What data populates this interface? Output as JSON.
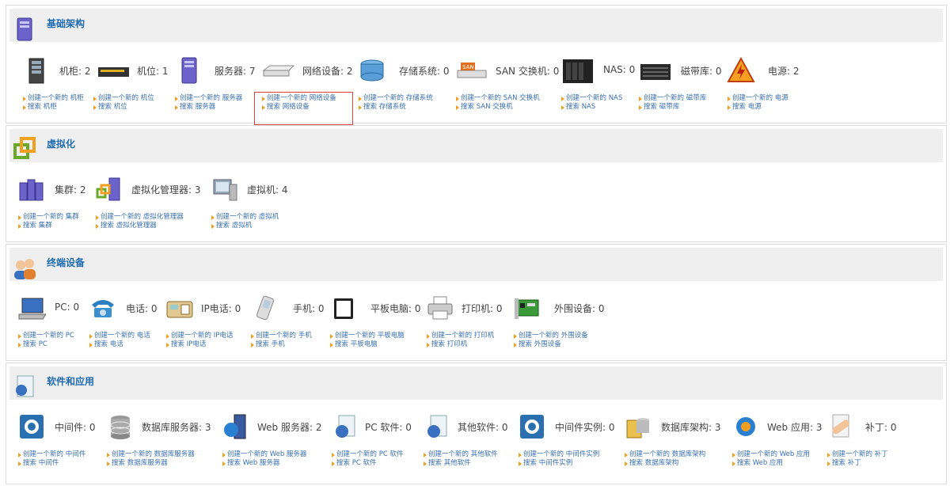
{
  "sections": [
    {
      "title": "基础架构",
      "items": [
        {
          "label": "机柜: 2",
          "create": "创建一个新的 机柜",
          "search": "搜索 机柜"
        },
        {
          "label": "机位: 1",
          "create": "创建一个新的 机位",
          "search": "搜索 机位"
        },
        {
          "label": "服务器: 7",
          "create": "创建一个新的 服务器",
          "search": "搜索 服务器"
        },
        {
          "label": "网络设备: 2",
          "create": "创建一个新的 网络设备",
          "search": "搜索 网络设备"
        },
        {
          "label": "存储系统: 0",
          "create": "创建一个新的 存储系统",
          "search": "搜索 存储系统"
        },
        {
          "label": "SAN 交换机: 0",
          "create": "创建一个新的 SAN 交换机",
          "search": "搜索 SAN 交换机"
        },
        {
          "label": "NAS: 0",
          "create": "创建一个新的 NAS",
          "search": "搜索 NAS"
        },
        {
          "label": "磁带库: 0",
          "create": "创建一个新的 磁带库",
          "search": "搜索 磁带库"
        },
        {
          "label": "电源: 2",
          "create": "创建一个新的 电源",
          "search": "搜索 电源"
        }
      ]
    },
    {
      "title": "虚拟化",
      "items": [
        {
          "label": "集群: 2",
          "create": "创建一个新的 集群",
          "search": "搜索 集群"
        },
        {
          "label": "虚拟化管理器: 3",
          "create": "创建一个新的 虚拟化管理器",
          "search": "搜索 虚拟化管理器"
        },
        {
          "label": "虚拟机: 4",
          "create": "创建一个新的 虚拟机",
          "search": "搜索 虚拟机"
        }
      ]
    },
    {
      "title": "终端设备",
      "items": [
        {
          "label": "PC: 0",
          "create": "创建一个新的 PC",
          "search": "搜索 PC"
        },
        {
          "label": "电话: 0",
          "create": "创建一个新的 电话",
          "search": "搜索 电话"
        },
        {
          "label": "IP电话: 0",
          "create": "创建一个新的 IP电话",
          "search": "搜索 IP电话"
        },
        {
          "label": "手机: 0",
          "create": "创建一个新的 手机",
          "search": "搜索 手机"
        },
        {
          "label": "平板电脑: 0",
          "create": "创建一个新的 平板电脑",
          "search": "搜索 平板电脑"
        },
        {
          "label": "打印机: 0",
          "create": "创建一个新的 打印机",
          "search": "搜索 打印机"
        },
        {
          "label": "外围设备: 0",
          "create": "创建一个新的 外围设备",
          "search": "搜索 外围设备"
        }
      ]
    },
    {
      "title": "软件和应用",
      "items": [
        {
          "label": "中间件: 0",
          "create": "创建一个新的 中间件",
          "search": "搜索 中间件"
        },
        {
          "label": "数据库服务器: 3",
          "create": "创建一个新的 数据库服务器",
          "search": "搜索 数据库服务器"
        },
        {
          "label": "Web 服务器: 2",
          "create": "创建一个新的 Web 服务器",
          "search": "搜索 Web 服务器"
        },
        {
          "label": "PC 软件: 0",
          "create": "创建一个新的 PC 软件",
          "search": "搜索 PC 软件"
        },
        {
          "label": "其他软件: 0",
          "create": "创建一个新的 其他软件",
          "search": "搜索 其他软件"
        },
        {
          "label": "中间件实例: 0",
          "create": "创建一个新的 中间件实例",
          "search": "搜索 中间件实例"
        },
        {
          "label": "数据库架构: 3",
          "create": "创建一个新的 数据库架构",
          "search": "搜索 数据库架构"
        },
        {
          "label": "Web 应用: 3",
          "create": "创建一个新的 Web 应用",
          "search": "搜索 Web 应用"
        },
        {
          "label": "补丁: 0",
          "create": "创建一个新的 补丁",
          "search": "搜索 补丁"
        }
      ]
    }
  ],
  "icons": {
    "sections": [
      "server-tower-icon",
      "virtualization-icon",
      "users-icon",
      "software-icon"
    ],
    "items": [
      [
        "rack-icon",
        "enclosure-icon",
        "server-icon",
        "network-device-icon",
        "storage-system-icon",
        "san-switch-icon",
        "nas-icon",
        "tape-library-icon",
        "power-icon"
      ],
      [
        "cluster-icon",
        "hypervisor-icon",
        "virtual-machine-icon"
      ],
      [
        "laptop-icon",
        "phone-icon",
        "ip-phone-icon",
        "mobile-phone-icon",
        "tablet-icon",
        "printer-icon",
        "peripheral-icon"
      ],
      [
        "middleware-icon",
        "database-server-icon",
        "web-server-icon",
        "pc-software-icon",
        "other-software-icon",
        "middleware-instance-icon",
        "database-schema-icon",
        "web-application-icon",
        "patch-icon"
      ]
    ]
  },
  "colors": {
    "section_title": "#1f6bb0",
    "link": "#3a6fb0",
    "bullet": "#f0a020",
    "highlight_border": "#e04040"
  }
}
